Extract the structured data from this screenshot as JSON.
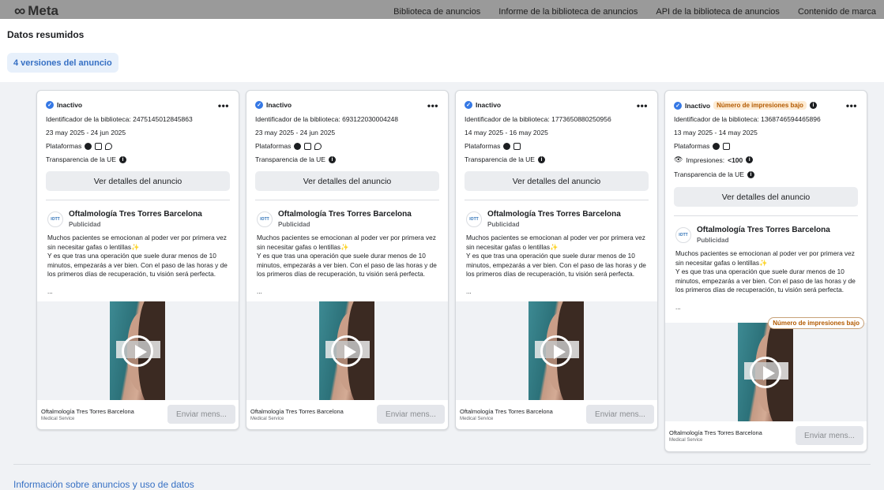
{
  "topbar": {
    "logo_text": "Meta",
    "nav": [
      "Biblioteca de anuncios",
      "Informe de la biblioteca de anuncios",
      "API de la biblioteca de anuncios",
      "Contenido de marca"
    ]
  },
  "modal": {
    "title": "Datos resumidos",
    "versions_label": "4 versiones del anuncio",
    "footer_link": "Información sobre anuncios y uso de datos"
  },
  "labels": {
    "platforms": "Plataformas",
    "transparency": "Transparencia de la UE",
    "details_button": "Ver detalles del anuncio",
    "impressions": "Impresiones:",
    "send_message": "Enviar mens...",
    "sponsored": "Publicidad"
  },
  "cards": [
    {
      "status": "Inactivo",
      "library_id": "Identificador de la biblioteca: 2475145012845863",
      "dates": "23 may 2025 - 24 jun 2025",
      "advertiser": "Oftalmología Tres Torres Barcelona",
      "body_line1": "Muchos pacientes se emocionan al poder ver por primera vez sin necesitar gafas o lentillas✨",
      "body_line2": "Y es que tras una operación que suele durar menos de 10 minutos, empezarás a ver bien. Con el paso de las horas y de los primeros días de recuperación, tu visión será perfecta.",
      "ellipsis": "...",
      "cta_name": "Oftalmología Tres Torres Barcelona",
      "cta_category": "Medical Service"
    },
    {
      "status": "Inactivo",
      "library_id": "Identificador de la biblioteca: 693122030004248",
      "dates": "23 may 2025 - 24 jun 2025",
      "advertiser": "Oftalmología Tres Torres Barcelona",
      "body_line1": "Muchos pacientes se emocionan al poder ver por primera vez sin necesitar gafas o lentillas✨",
      "body_line2": "Y es que tras una operación que suele durar menos de 10 minutos, empezarás a ver bien. Con el paso de las horas y de los primeros días de recuperación, tu visión será perfecta.",
      "ellipsis": "...",
      "cta_name": "Oftalmología Tres Torres Barcelona",
      "cta_category": "Medical Service"
    },
    {
      "status": "Inactivo",
      "library_id": "Identificador de la biblioteca: 1773650880250956",
      "dates": "14 may 2025 - 16 may 2025",
      "advertiser": "Oftalmología Tres Torres Barcelona",
      "body_line1": "Muchos pacientes se emocionan al poder ver por primera vez sin necesitar gafas o lentillas✨",
      "body_line2": "Y es que tras una operación que suele durar menos de 10 minutos, empezarás a ver bien. Con el paso de las horas y de los primeros días de recuperación, tu visión será perfecta.",
      "ellipsis": "...",
      "cta_name": "Oftalmología Tres Torres Barcelona",
      "cta_category": "Medical Service"
    },
    {
      "status": "Inactivo",
      "low_impressions_badge": "Número de impresiones bajo",
      "library_id": "Identificador de la biblioteca: 1368746594465896",
      "dates": "13 may 2025 - 14 may 2025",
      "impressions_value": "<100",
      "advertiser": "Oftalmología Tres Torres Barcelona",
      "body_line1": "Muchos pacientes se emocionan al poder ver por primera vez sin necesitar gafas o lentillas✨",
      "body_line2": "Y es que tras una operación que suele durar menos de 10 minutos, empezarás a ver bien. Con el paso de las horas y de los primeros días de recuperación, tu visión será perfecta.",
      "ellipsis": "...",
      "media_badge": "Número de impresiones bajo",
      "cta_name": "Oftalmología Tres Torres Barcelona",
      "cta_category": "Medical Service"
    }
  ],
  "colors": {
    "accent": "#3670c4",
    "badge_text": "#b35a00",
    "badge_bg": "#fdebd3",
    "button_bg": "#ebedf0"
  }
}
